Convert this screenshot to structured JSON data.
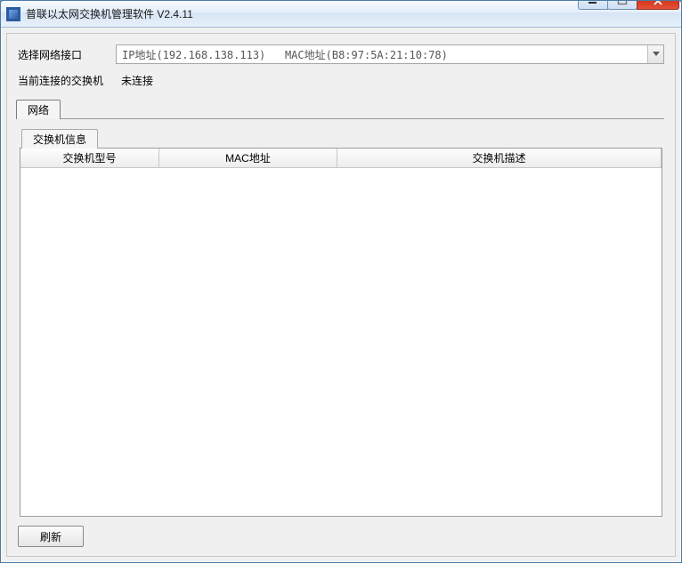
{
  "window": {
    "title": "普联以太网交换机管理软件 V2.4.11"
  },
  "form": {
    "interface_label": "选择网络接口",
    "interface_value": "IP地址(192.168.138.113)   MAC地址(B8:97:5A:21:10:78)",
    "current_switch_label": "当前连接的交换机",
    "current_switch_value": "未连接"
  },
  "tabs": {
    "network": "网络"
  },
  "inner_tabs": {
    "switch_info": "交换机信息"
  },
  "table": {
    "columns": {
      "model": "交换机型号",
      "mac": "MAC地址",
      "desc": "交换机描述"
    },
    "rows": []
  },
  "buttons": {
    "refresh": "刷新"
  }
}
